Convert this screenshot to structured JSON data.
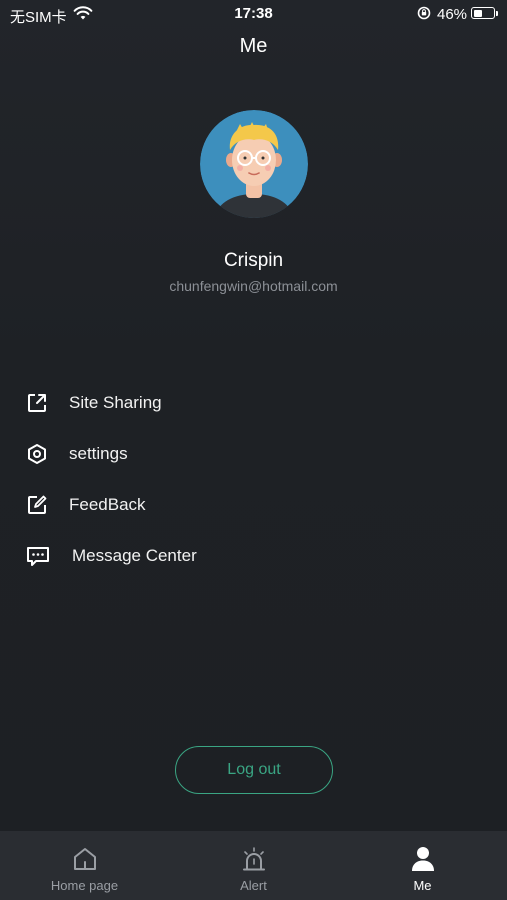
{
  "status_bar": {
    "carrier": "无SIM卡",
    "time": "17:38",
    "battery_percent": "46%",
    "battery_level": 0.46
  },
  "header": {
    "title": "Me"
  },
  "profile": {
    "name": "Crispin",
    "email": "chunfengwin@hotmail.com"
  },
  "menu": {
    "items": [
      {
        "label": "Site Sharing",
        "icon": "share-icon"
      },
      {
        "label": "settings",
        "icon": "settings-icon"
      },
      {
        "label": "FeedBack",
        "icon": "edit-icon"
      },
      {
        "label": "Message Center",
        "icon": "message-icon"
      }
    ]
  },
  "logout": {
    "label": "Log out"
  },
  "tab_bar": {
    "tabs": [
      {
        "label": "Home page",
        "icon": "home-icon",
        "active": false
      },
      {
        "label": "Alert",
        "icon": "alarm-icon",
        "active": false
      },
      {
        "label": "Me",
        "icon": "person-icon",
        "active": true
      }
    ]
  },
  "colors": {
    "background": "#1f2226",
    "accent": "#3aa583",
    "tab_bar": "#2a2d32",
    "muted_text": "#8c9096"
  }
}
